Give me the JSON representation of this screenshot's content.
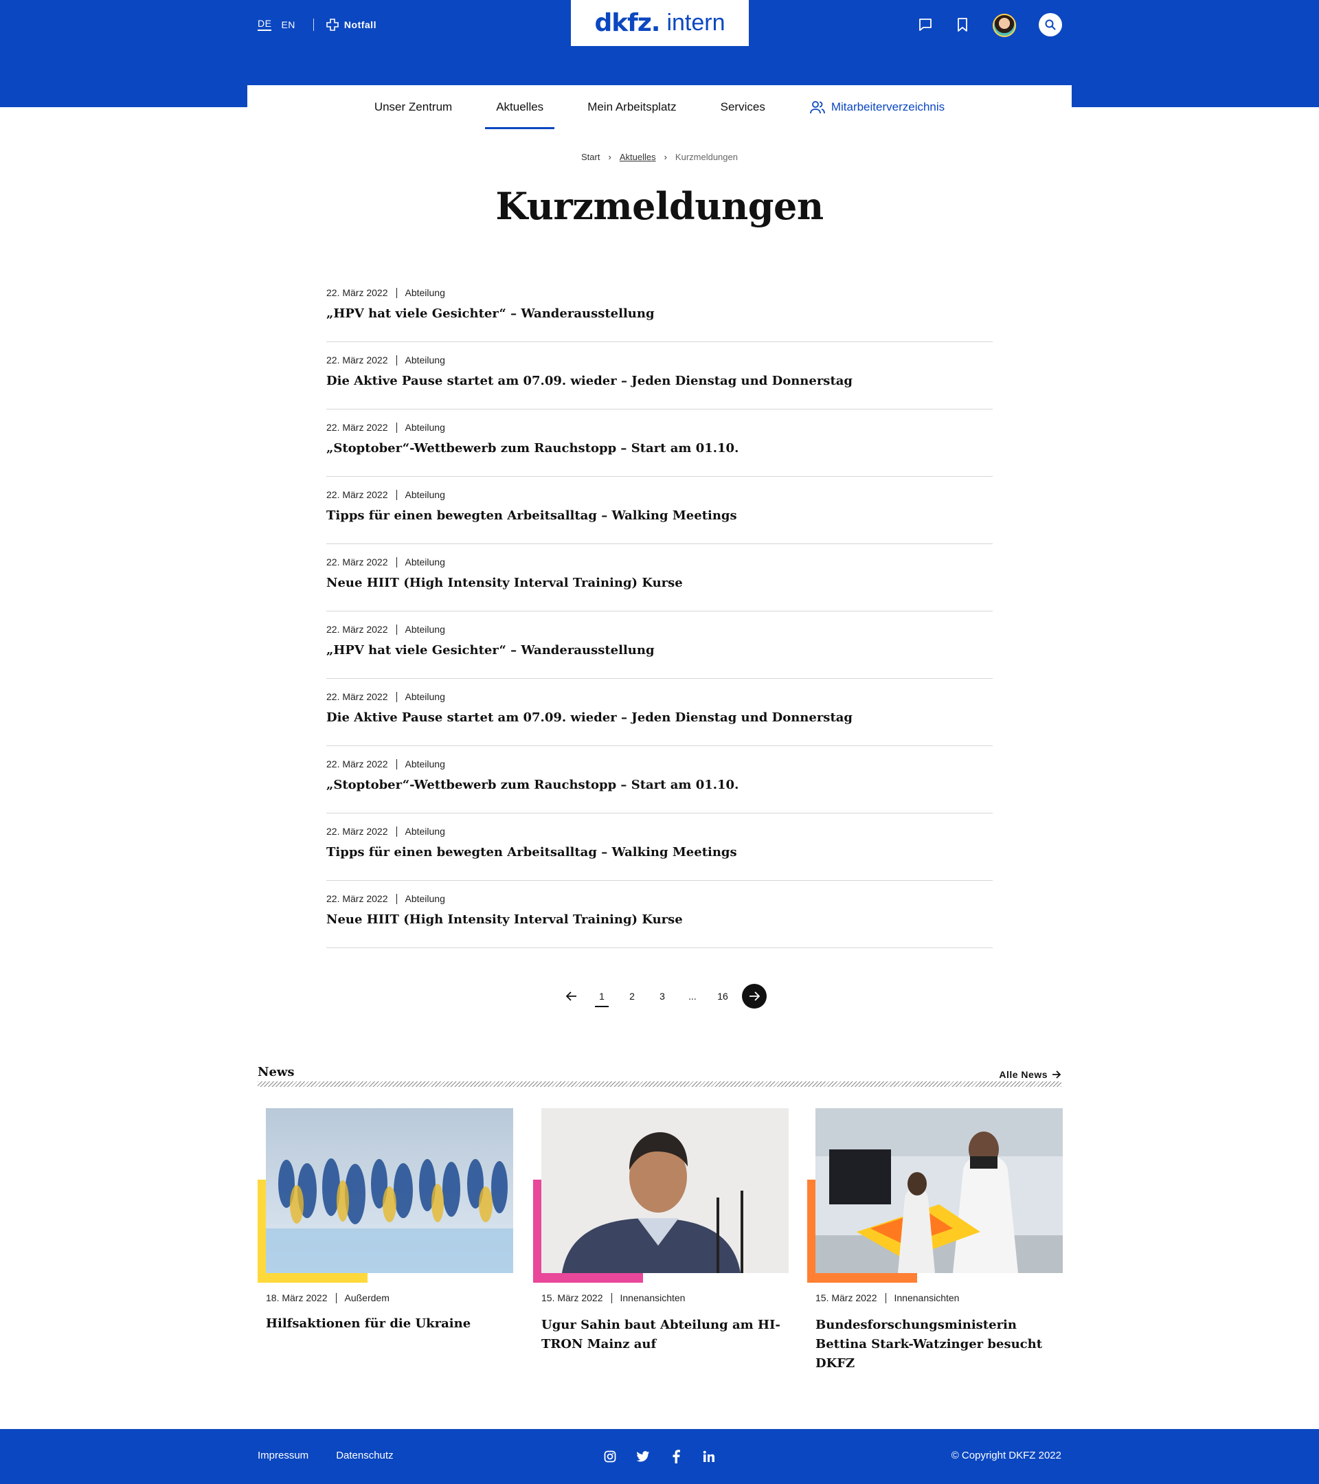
{
  "header": {
    "lang_de": "DE",
    "lang_en": "EN",
    "notfall": "Notfall",
    "logo_main": "dkfz.",
    "logo_sub": "intern",
    "brand_color": "#0b47c0"
  },
  "nav": {
    "items": [
      "Unser Zentrum",
      "Aktuelles",
      "Mein Arbeitsplatz",
      "Services"
    ],
    "active": "Aktuelles",
    "directory": "Mitarbeiterverzeichnis"
  },
  "breadcrumb": [
    "Start",
    "Aktuelles",
    "Kurzmeldungen"
  ],
  "page_title": "Kurzmeldungen",
  "list": [
    {
      "date": "22. März 2022",
      "category": "Abteilung",
      "title": "„HPV hat viele Gesichter“ – Wanderausstellung"
    },
    {
      "date": "22. März 2022",
      "category": "Abteilung",
      "title": "Die Aktive Pause startet am 07.09. wieder – Jeden Dienstag und Donnerstag"
    },
    {
      "date": "22. März 2022",
      "category": "Abteilung",
      "title": "„Stoptober“-Wettbewerb zum Rauchstopp – Start am 01.10."
    },
    {
      "date": "22. März 2022",
      "category": "Abteilung",
      "title": "Tipps für einen bewegten Arbeitsalltag – Walking Meetings"
    },
    {
      "date": "22. März 2022",
      "category": "Abteilung",
      "title": "Neue HIIT (High Intensity Interval Training) Kurse"
    },
    {
      "date": "22. März 2022",
      "category": "Abteilung",
      "title": "„HPV hat viele Gesichter“ – Wanderausstellung"
    },
    {
      "date": "22. März 2022",
      "category": "Abteilung",
      "title": "Die Aktive Pause startet am 07.09. wieder – Jeden Dienstag und Donnerstag"
    },
    {
      "date": "22. März 2022",
      "category": "Abteilung",
      "title": "„Stoptober“-Wettbewerb zum Rauchstopp – Start am 01.10."
    },
    {
      "date": "22. März 2022",
      "category": "Abteilung",
      "title": "Tipps für einen bewegten Arbeitsalltag – Walking Meetings"
    },
    {
      "date": "22. März 2022",
      "category": "Abteilung",
      "title": "Neue HIIT (High Intensity Interval Training) Kurse"
    }
  ],
  "pagination": {
    "pages": [
      "1",
      "2",
      "3",
      "...",
      "16"
    ],
    "current": "1"
  },
  "news": {
    "heading": "News",
    "all_link": "Alle News",
    "cards": [
      {
        "date": "18. März 2022",
        "category": "Außerdem",
        "title": "Hilfsaktionen für die Ukraine",
        "accent": "#ffd93b"
      },
      {
        "date": "15. März 2022",
        "category": "Innenansichten",
        "title": "Ugur Sahin baut Abteilung am HI-TRON Mainz auf",
        "accent": "#e8479a"
      },
      {
        "date": "15. März 2022",
        "category": "Innenansichten",
        "title": "Bundesforschungsministerin Bettina Stark-Watzinger besucht DKFZ",
        "accent": "#ff7f33"
      }
    ]
  },
  "footer": {
    "impressum": "Impressum",
    "datenschutz": "Datenschutz",
    "social": [
      "instagram-icon",
      "twitter-icon",
      "facebook-icon",
      "linkedin-icon"
    ],
    "copyright": "© Copyright DKFZ 2022"
  }
}
